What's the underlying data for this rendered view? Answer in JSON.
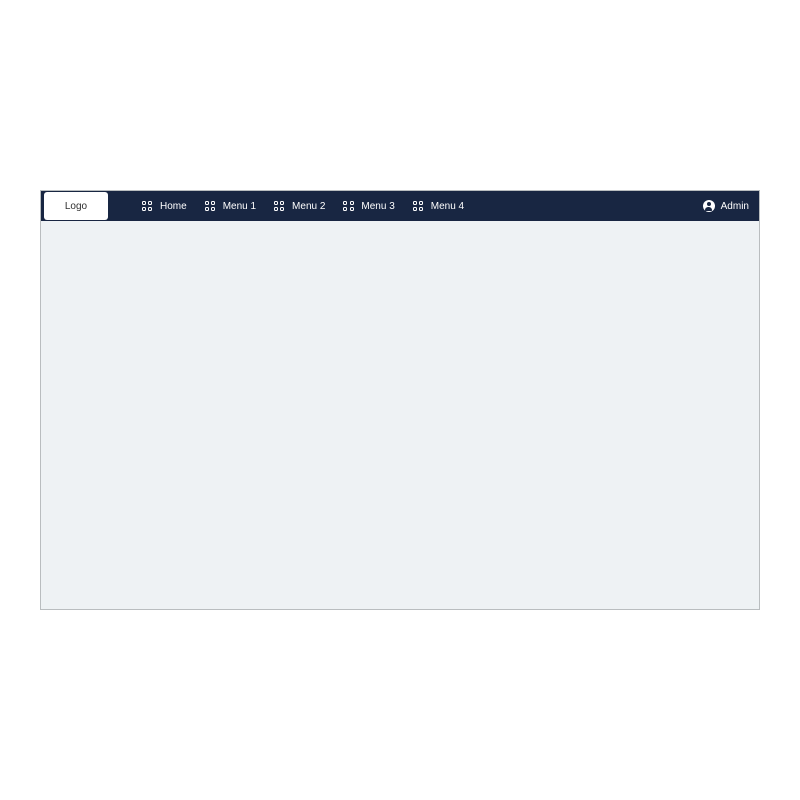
{
  "navbar": {
    "logo_label": "Logo",
    "menu": [
      {
        "label": "Home"
      },
      {
        "label": "Menu 1"
      },
      {
        "label": "Menu 2"
      },
      {
        "label": "Menu 3"
      },
      {
        "label": "Menu 4"
      }
    ],
    "user_label": "Admin"
  },
  "colors": {
    "navbar_bg": "#182642",
    "content_bg": "#eef2f4",
    "border": "#b9bdbf",
    "navbar_text": "#ffffff",
    "logo_bg": "#ffffff",
    "logo_text": "#2e2e2e"
  }
}
